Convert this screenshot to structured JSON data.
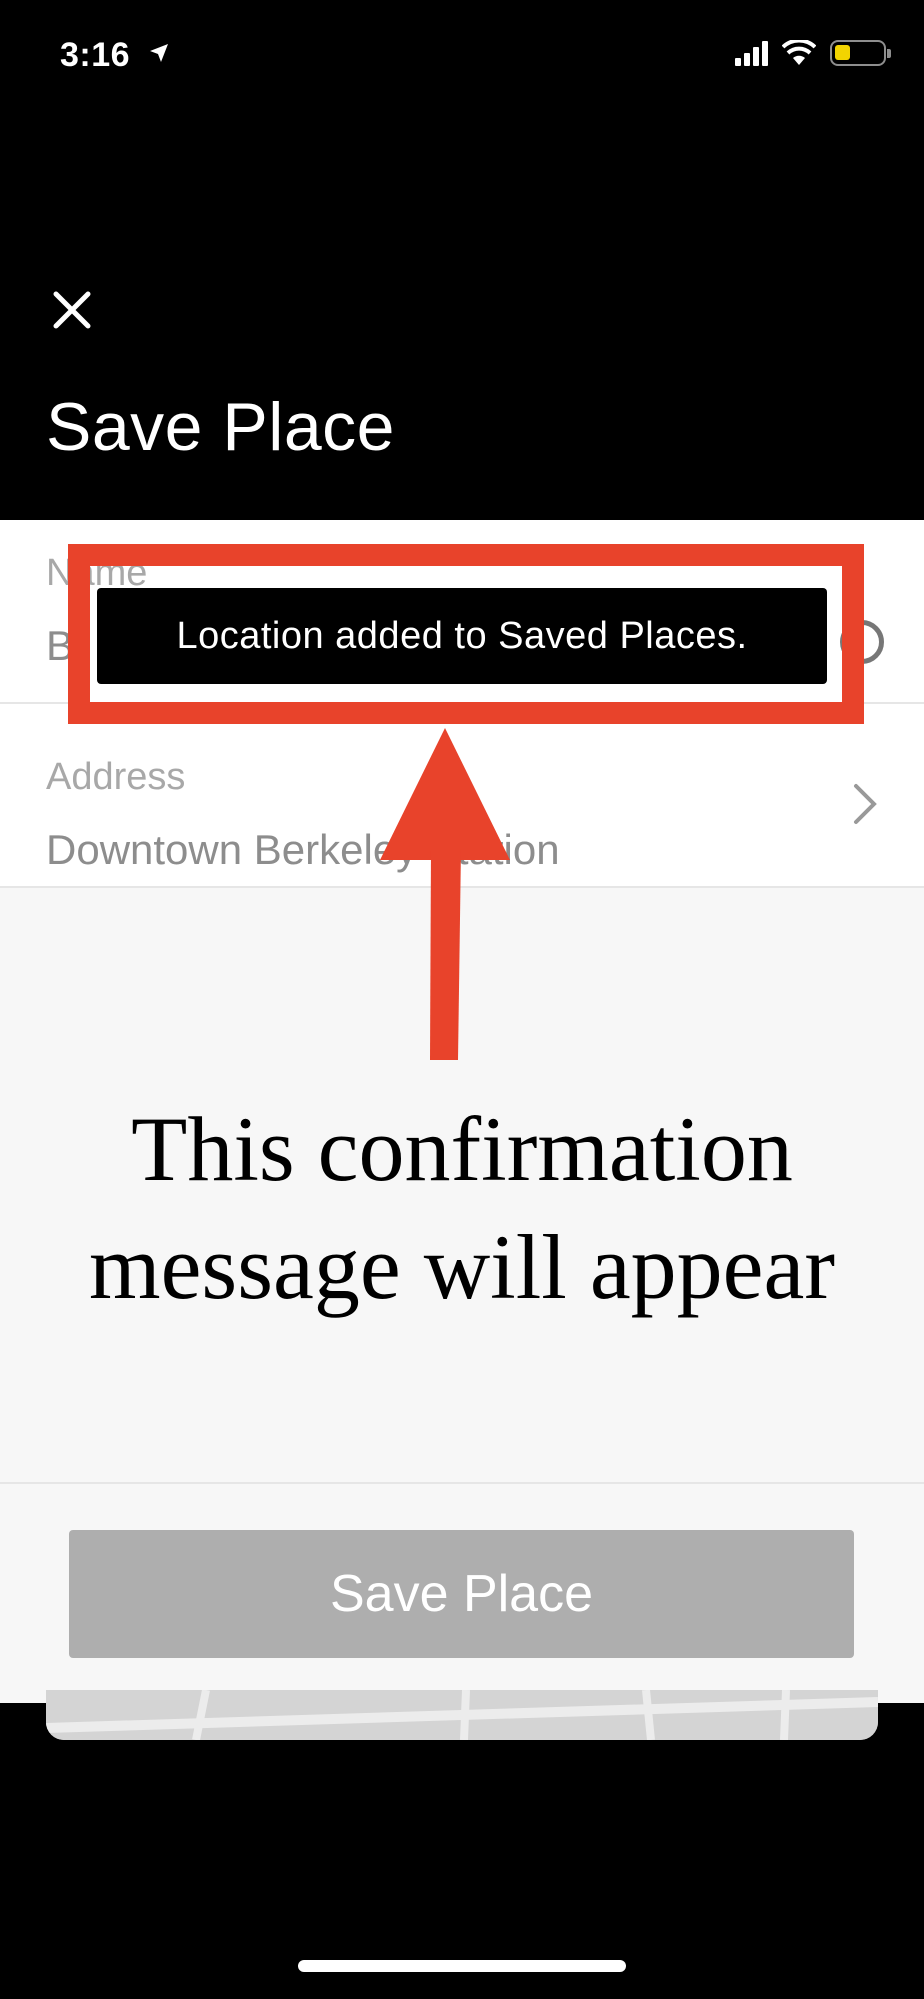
{
  "status_bar": {
    "time": "3:16",
    "location_icon": "location-arrow-icon",
    "signal_icon": "cellular-signal-icon",
    "wifi_icon": "wifi-icon",
    "battery_icon": "battery-low-icon",
    "battery_color": "#f2d400"
  },
  "header": {
    "close_icon": "close-icon",
    "title": "Save Place"
  },
  "form": {
    "name": {
      "label": "Name",
      "value": "B"
    },
    "address": {
      "label": "Address",
      "value": "Downtown Berkeley Station"
    }
  },
  "toast": {
    "message": "Location added to Saved Places."
  },
  "annotation": {
    "line1": "This confirmation",
    "line2": "message will appear",
    "color": "#e8432b"
  },
  "footer": {
    "save_label": "Save Place"
  }
}
